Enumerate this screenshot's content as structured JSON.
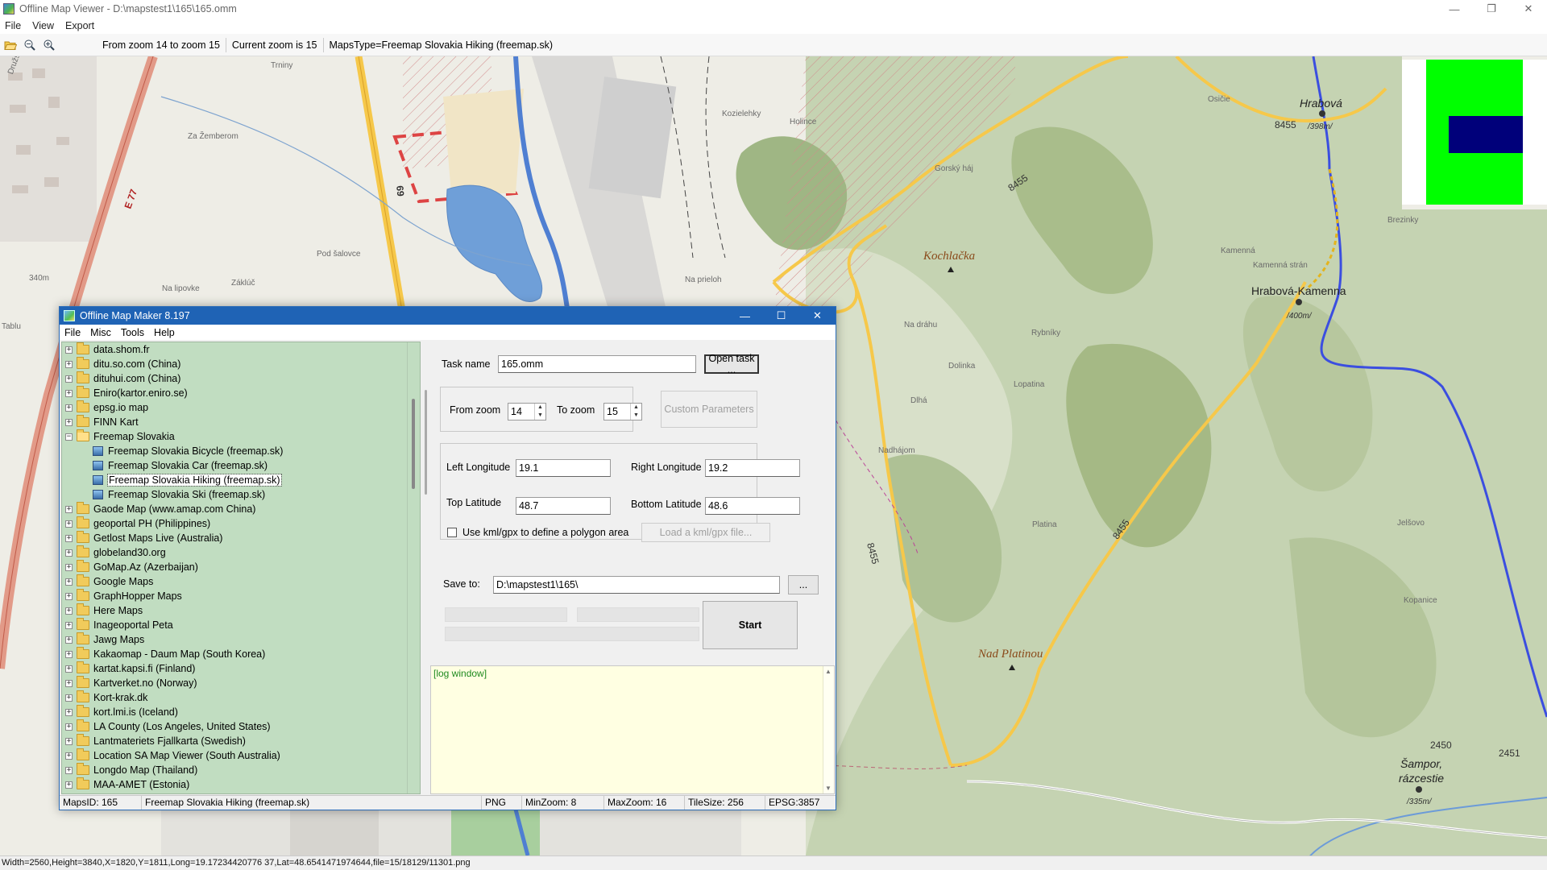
{
  "window": {
    "title": "Offline Map Viewer - D:\\mapstest1\\165\\165.omm",
    "controls": {
      "minimize": "—",
      "maximize": "❐",
      "close": "✕"
    }
  },
  "menu": [
    "File",
    "View",
    "Export"
  ],
  "toolbar": {
    "open_icon": "folder-open-icon",
    "zoom_out_icon": "zoom-out-icon",
    "zoom_in_icon": "zoom-in-icon",
    "zoom_range": "From zoom 14 to zoom 15",
    "current_zoom": "Current zoom is 15",
    "maps_type": "MapsType=Freemap Slovakia Hiking (freemap.sk)"
  },
  "map": {
    "labels": {
      "trniny": "Trniny",
      "za_zemberom": "Za Žemberom",
      "pod_salovce": "Pod šalovce",
      "na_lipovke": "Na lipovke",
      "zakluc": "Záklúč",
      "na_prieloh": "Na prieloh",
      "kozie_lehky": "Kozielehky",
      "holince": "Holince",
      "gorsky_haj": "Gorský háj",
      "kochlacka": "Kochlačka",
      "na_drahu": "Na dráhu",
      "dolinka": "Dolinka",
      "lopatina": "Lopatina",
      "dlha": "Dlhá",
      "nadhajom": "Nadhájom",
      "rybniky": "Rybníky",
      "platina": "Platina",
      "nad_platinou": "Nad Platinou",
      "hrabova": "Hrabová",
      "hrabova_kamenna": "Hrabová-Kamenna",
      "sampor": "Šampor,",
      "razcestie": "rázcestie",
      "kamenna": "Kamenná",
      "kamenna_stran": "Kamenná strán",
      "osicie": "Osičie",
      "jelsovo": "Jelšovo",
      "kopanice": "Kopanice",
      "brezinky": "Brezinky",
      "drusstevna": "Družstevná",
      "tablu": "Tablu",
      "alt_340": "340m",
      "alt_398": "/398m/",
      "alt_400": "/400m/",
      "alt_335": "/335m/",
      "road_8455_a": "8455",
      "road_8455_b": "8455",
      "road_8455_c": "8455",
      "road_8455_d": "8455",
      "road_2450": "2450",
      "road_2451": "2451",
      "road_69": "69",
      "road_e77": "E 77"
    },
    "minimap": {
      "bg": "#ffffff",
      "area": "#00ff00",
      "selection": "#00007a"
    }
  },
  "statusbar": "Width=2560,Height=3840,X=1820,Y=1811,Long=19.17234420776 37,Lat=48.6541471974644,file=15/18129/11301.png",
  "dialog": {
    "title": "Offline Map Maker 8.197",
    "menu": [
      "File",
      "Misc",
      "Tools",
      "Help"
    ],
    "tree": [
      {
        "label": "data.shom.fr",
        "type": "folder"
      },
      {
        "label": "ditu.so.com (China)",
        "type": "folder"
      },
      {
        "label": "dituhui.com (China)",
        "type": "folder"
      },
      {
        "label": "Eniro(kartor.eniro.se)",
        "type": "folder"
      },
      {
        "label": "epsg.io map",
        "type": "folder"
      },
      {
        "label": "FINN Kart",
        "type": "folder"
      },
      {
        "label": "Freemap Slovakia",
        "type": "folder-open"
      },
      {
        "label": "Freemap Slovakia Bicycle (freemap.sk)",
        "type": "map"
      },
      {
        "label": "Freemap Slovakia Car (freemap.sk)",
        "type": "map"
      },
      {
        "label": "Freemap Slovakia Hiking (freemap.sk)",
        "type": "map",
        "selected": true
      },
      {
        "label": "Freemap Slovakia Ski (freemap.sk)",
        "type": "map"
      },
      {
        "label": "Gaode Map (www.amap.com China)",
        "type": "folder"
      },
      {
        "label": "geoportal PH (Philippines)",
        "type": "folder"
      },
      {
        "label": "Getlost Maps Live (Australia)",
        "type": "folder"
      },
      {
        "label": "globeland30.org",
        "type": "folder"
      },
      {
        "label": "GoMap.Az (Azerbaijan)",
        "type": "folder"
      },
      {
        "label": "Google Maps",
        "type": "folder"
      },
      {
        "label": "GraphHopper Maps",
        "type": "folder"
      },
      {
        "label": "Here Maps",
        "type": "folder"
      },
      {
        "label": "Inageoportal Peta",
        "type": "folder"
      },
      {
        "label": "Jawg Maps",
        "type": "folder"
      },
      {
        "label": "Kakaomap - Daum Map (South Korea)",
        "type": "folder"
      },
      {
        "label": "kartat.kapsi.fi (Finland)",
        "type": "folder"
      },
      {
        "label": "Kartverket.no (Norway)",
        "type": "folder"
      },
      {
        "label": "Kort-krak.dk",
        "type": "folder"
      },
      {
        "label": "kort.lmi.is (Iceland)",
        "type": "folder"
      },
      {
        "label": "LA County (Los Angeles, United States)",
        "type": "folder"
      },
      {
        "label": "Lantmateriets Fjallkarta (Swedish)",
        "type": "folder"
      },
      {
        "label": "Location SA Map Viewer (South Australia)",
        "type": "folder"
      },
      {
        "label": "Longdo Map (Thailand)",
        "type": "folder"
      },
      {
        "label": "MAA-AMET (Estonia)",
        "type": "folder"
      }
    ],
    "form": {
      "task_name_label": "Task name",
      "task_name_value": "165.omm",
      "open_task_button": "Open task ...",
      "from_zoom_label": "From zoom",
      "from_zoom_value": "14",
      "to_zoom_label": "To zoom",
      "to_zoom_value": "15",
      "custom_params_button": "Custom Parameters",
      "left_lon_label": "Left Longitude",
      "left_lon_value": "19.1",
      "right_lon_label": "Right Longitude",
      "right_lon_value": "19.2",
      "top_lat_label": "Top Latitude",
      "top_lat_value": "48.7",
      "bottom_lat_label": "Bottom Latitude",
      "bottom_lat_value": "48.6",
      "kml_checkbox_label": "Use kml/gpx to define a polygon area",
      "kml_checked": false,
      "load_kml_button": "Load a kml/gpx file...",
      "save_to_label": "Save to:",
      "save_to_value": "D:\\mapstest1\\165\\",
      "browse_button": "...",
      "start_button": "Start"
    },
    "log": "[log window]",
    "status": {
      "maps_id": "MapsID: 165",
      "maps_name": "Freemap Slovakia Hiking (freemap.sk)",
      "format": "PNG",
      "min_zoom": "MinZoom: 8",
      "max_zoom": "MaxZoom: 16",
      "tile_size": "TileSize: 256",
      "epsg": "EPSG:3857"
    }
  }
}
